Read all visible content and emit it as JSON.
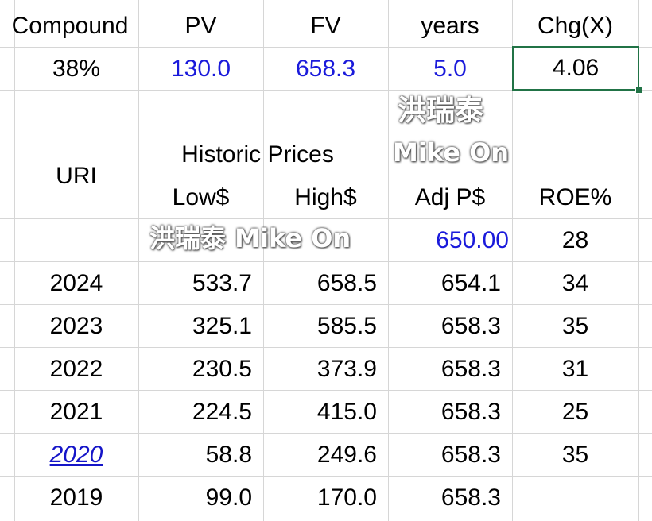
{
  "header": {
    "compound_label": "Compound",
    "pv_label": "PV",
    "fv_label": "FV",
    "years_label": "years",
    "chg_label": "Chg(X)"
  },
  "values": {
    "compound": "38%",
    "pv": "130.0",
    "fv": "658.3",
    "years": "5.0",
    "chg": "4.06"
  },
  "ticker": "URI",
  "historic_label": "Historic Prices",
  "columns": {
    "low": "Low$",
    "high": "High$",
    "adj": "Adj P$",
    "roe": "ROE%"
  },
  "current": {
    "adj": "650.00",
    "roe": "28"
  },
  "rows": [
    {
      "year": "2024",
      "low": "533.7",
      "high": "658.5",
      "adj": "654.1",
      "roe": "34"
    },
    {
      "year": "2023",
      "low": "325.1",
      "high": "585.5",
      "adj": "658.3",
      "roe": "35"
    },
    {
      "year": "2022",
      "low": "230.5",
      "high": "373.9",
      "adj": "658.3",
      "roe": "31"
    },
    {
      "year": "2021",
      "low": "224.5",
      "high": "415.0",
      "adj": "658.3",
      "roe": "25"
    },
    {
      "year": "2020",
      "low": "58.8",
      "high": "249.6",
      "adj": "658.3",
      "roe": "35"
    },
    {
      "year": "2019",
      "low": "99.0",
      "high": "170.0",
      "adj": "658.3",
      "roe": ""
    }
  ],
  "watermarks": {
    "chinese": "洪瑞泰",
    "latin": "Mike On",
    "combined": "洪瑞泰 Mike On"
  },
  "colors": {
    "input_blue": "#1a1adb",
    "selection_green": "#217346",
    "gridline": "#d6d6d6"
  }
}
